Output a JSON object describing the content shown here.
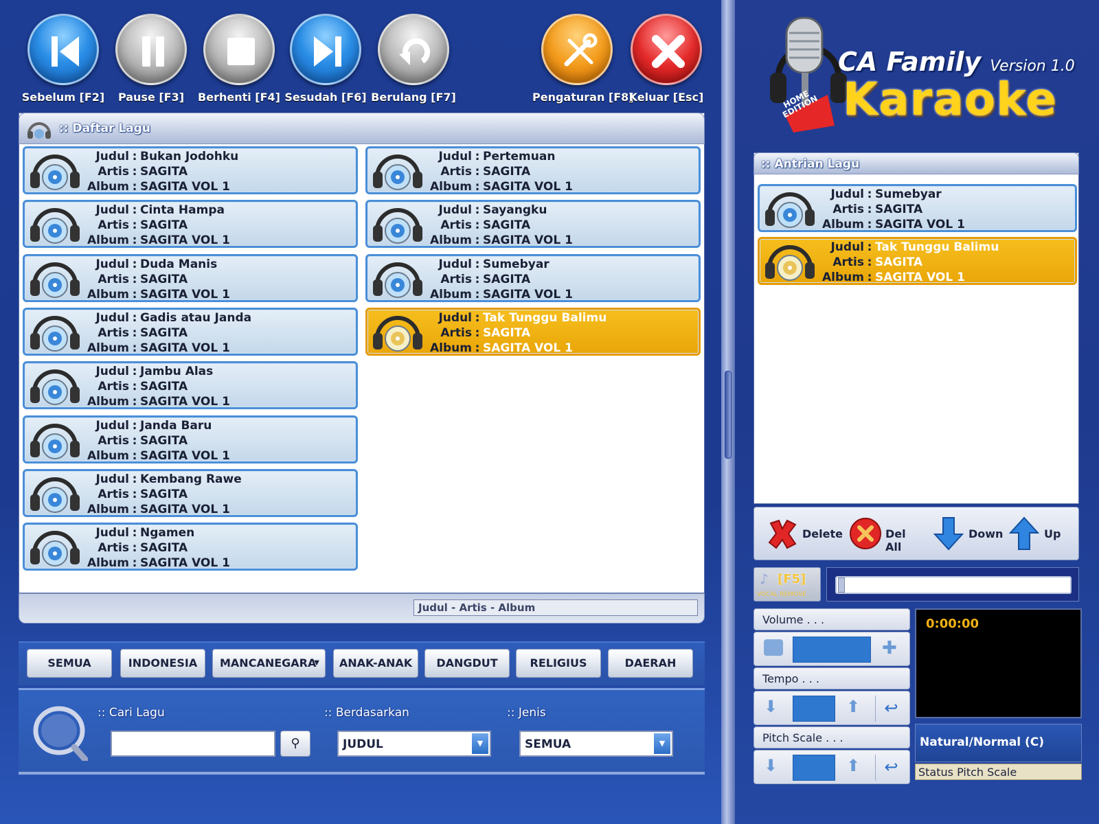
{
  "toolbar": {
    "buttons": [
      {
        "label": "Sebelum [F2]"
      },
      {
        "label": "Pause [F3]"
      },
      {
        "label": "Berhenti [F4]"
      },
      {
        "label": "Sesudah [F6]"
      },
      {
        "label": "Berulang [F7]"
      },
      {
        "label": "Pengaturan [F8]"
      },
      {
        "label": "Keluar [Esc]"
      }
    ]
  },
  "logo": {
    "line1": "CA Family",
    "version": "Version 1.0",
    "line2": "Karaoke",
    "badge": "HOME EDITION"
  },
  "song_list": {
    "title": ":: Daftar Lagu",
    "keys": {
      "title": "Judul",
      "artist": "Artis",
      "album": "Album"
    },
    "left": [
      {
        "title": "Bukan Jodohku",
        "artist": "SAGITA",
        "album": "SAGITA VOL 1"
      },
      {
        "title": "Cinta Hampa",
        "artist": "SAGITA",
        "album": "SAGITA VOL 1"
      },
      {
        "title": "Duda Manis",
        "artist": "SAGITA",
        "album": "SAGITA VOL 1"
      },
      {
        "title": "Gadis atau Janda",
        "artist": "SAGITA",
        "album": "SAGITA VOL 1"
      },
      {
        "title": "Jambu Alas",
        "artist": "SAGITA",
        "album": "SAGITA VOL 1"
      },
      {
        "title": "Janda Baru",
        "artist": "SAGITA",
        "album": "SAGITA VOL 1"
      },
      {
        "title": "Kembang Rawe",
        "artist": "SAGITA",
        "album": "SAGITA VOL 1"
      },
      {
        "title": "Ngamen",
        "artist": "SAGITA",
        "album": "SAGITA VOL 1"
      }
    ],
    "right": [
      {
        "title": "Pertemuan",
        "artist": "SAGITA",
        "album": "SAGITA VOL 1"
      },
      {
        "title": "Sayangku",
        "artist": "SAGITA",
        "album": "SAGITA VOL 1"
      },
      {
        "title": "Sumebyar",
        "artist": "SAGITA",
        "album": "SAGITA VOL 1"
      },
      {
        "title": "Tak Tunggu Balimu",
        "artist": "SAGITA",
        "album": "SAGITA VOL 1",
        "selected": true
      }
    ],
    "footer_label": "Judul - Artis - Album"
  },
  "categories": {
    "items": [
      "SEMUA",
      "INDONESIA",
      "MANCANEGARA",
      "ANAK-ANAK",
      "DANGDUT",
      "RELIGIUS",
      "DAERAH"
    ]
  },
  "search": {
    "label": ":: Cari Lagu",
    "value": "",
    "by_label": ":: Berdasarkan",
    "by_value": "JUDUL",
    "type_label": ":: Jenis",
    "type_value": "SEMUA"
  },
  "queue": {
    "title": ":: Antrian Lagu",
    "items": [
      {
        "title": "Sumebyar",
        "artist": "SAGITA",
        "album": "SAGITA VOL 1"
      },
      {
        "title": "Tak Tunggu Balimu",
        "artist": "SAGITA",
        "album": "SAGITA VOL 1",
        "selected": true
      }
    ],
    "actions": {
      "delete": "Delete",
      "del_all": "Del All",
      "down": "Down",
      "up": "Up"
    }
  },
  "vocal_remove": {
    "key": "[F5]",
    "caption": "VOCAL REMOVE"
  },
  "controls": {
    "volume_label": "Volume . . .",
    "tempo_label": "Tempo . . .",
    "pitch_label": "Pitch Scale . . .",
    "time": "0:00:00",
    "pitch_status": "Natural/Normal (C)",
    "pitch_status_label": "Status Pitch Scale"
  },
  "colors": {
    "background": "#1c3a8f",
    "selected": "#f1b214",
    "card": "#d4e4f2",
    "card_border": "#4a8ed8",
    "logo_yellow": "#ffd21c"
  }
}
